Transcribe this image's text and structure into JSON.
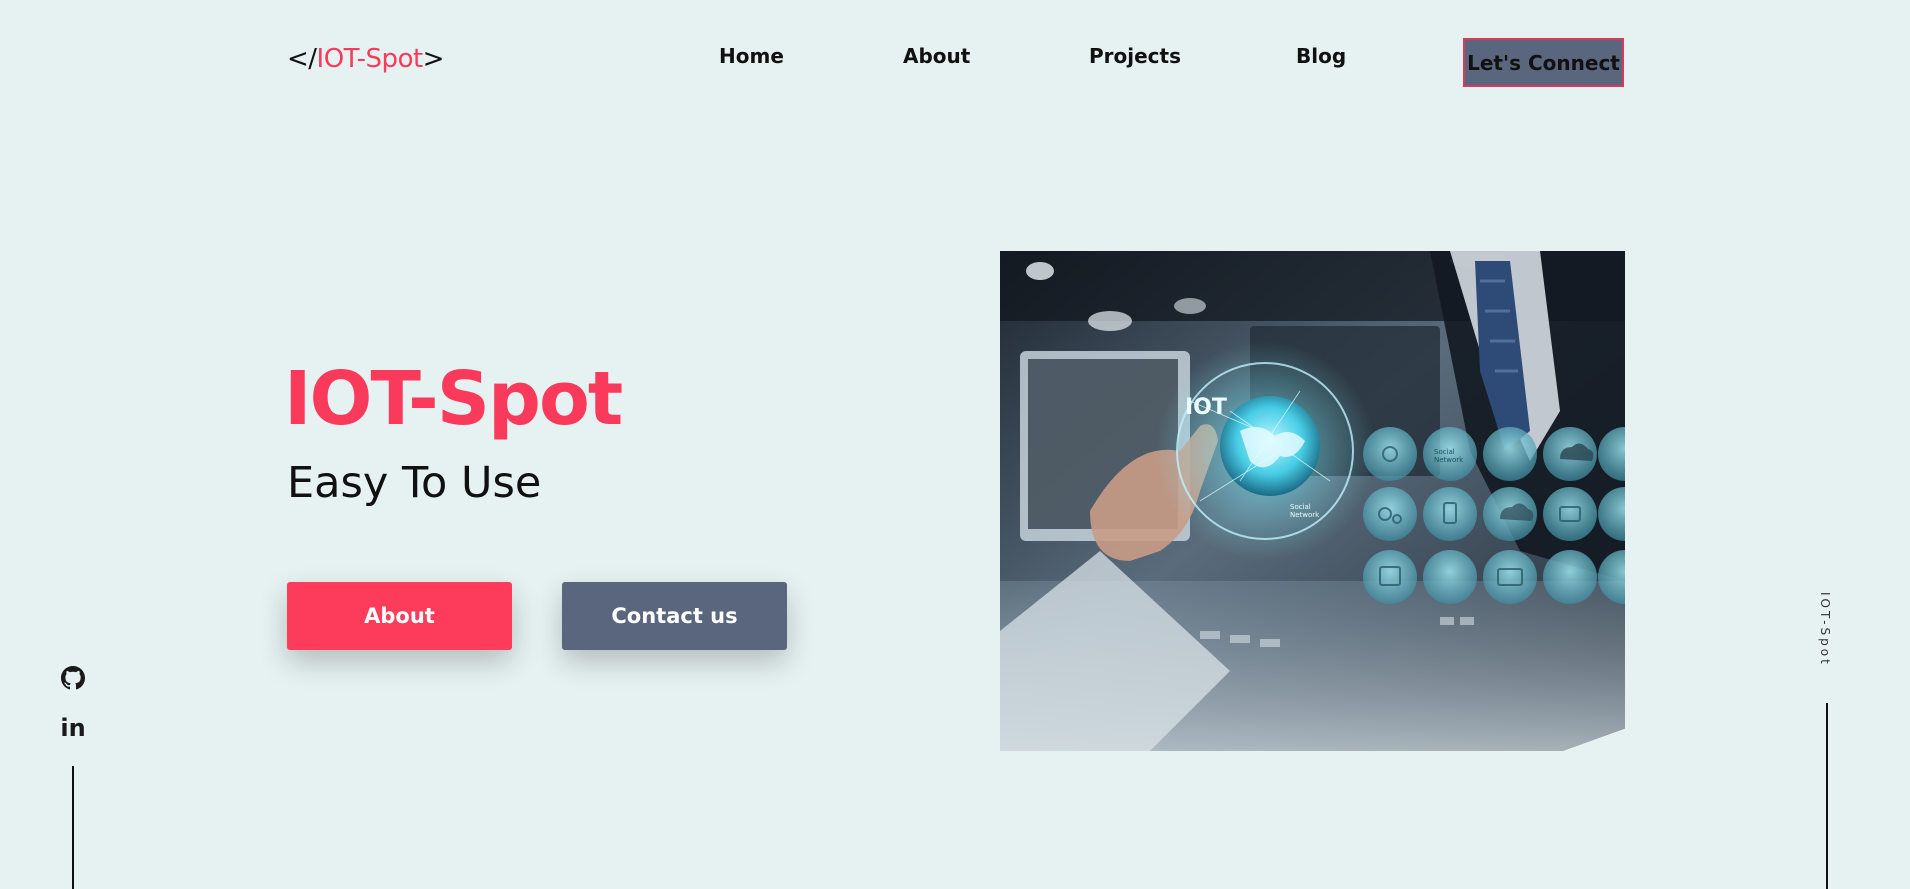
{
  "logo": {
    "prefix": "</",
    "name": "IOT-Spot",
    "suffix": ">"
  },
  "nav": {
    "items": [
      {
        "label": "Home"
      },
      {
        "label": "About"
      },
      {
        "label": "Projects"
      },
      {
        "label": "Blog"
      }
    ],
    "cta_label": "Let's Connect"
  },
  "hero": {
    "title": "IOT-Spot",
    "subtitle": "Easy To Use",
    "about_button": "About",
    "contact_button": "Contact us"
  },
  "image": {
    "iot_text": "IOT",
    "globe_label_1": "Social",
    "globe_label_2": "Network",
    "bubble_label_1": "Social",
    "bubble_label_2": "Network"
  },
  "social": {
    "icons": [
      "github-icon",
      "linkedin-icon"
    ],
    "linkedin_text": "in"
  },
  "side_brand": "IOT-Spot",
  "colors": {
    "background": "#e6f2f2",
    "accent": "#fa3a5b",
    "slate": "#5a667e",
    "text": "#111111"
  }
}
